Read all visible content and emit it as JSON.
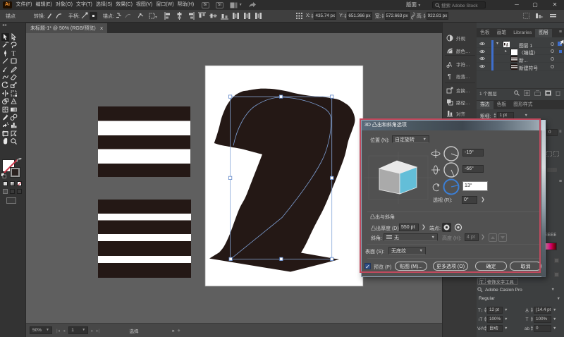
{
  "window": {
    "logo": "Ai",
    "workspace": "版面",
    "search_placeholder": "搜索 Adobe Stock",
    "minimize": "─",
    "maximize": "▢",
    "close": "✕"
  },
  "menu": {
    "items": [
      "文件(F)",
      "编辑(E)",
      "对象(O)",
      "文字(T)",
      "选择(S)",
      "效果(C)",
      "视图(V)",
      "窗口(W)",
      "帮助(H)"
    ],
    "bridge_icon": "Br",
    "stock_icon": "St"
  },
  "control_bar": {
    "mode_label": "锚点",
    "convert_label": "转换:",
    "handles_label": "手柄:",
    "anchors_label": "锚点:",
    "x_label": "X:",
    "x_value": "435.74 px",
    "y_label": "Y:",
    "y_value": "651.366 px",
    "w_label": "宽:",
    "w_value": "572.663 px",
    "h_label": "高:",
    "h_value": "922.81 px"
  },
  "document_tab": {
    "title": "未标题-1* @ 50% (RGB/预览)",
    "close": "×"
  },
  "tools": [
    "selection",
    "direct-selection",
    "magic-wand",
    "lasso",
    "pen",
    "type",
    "line-segment",
    "rectangle",
    "paintbrush",
    "pencil",
    "shaper",
    "eraser",
    "rotate",
    "scale",
    "width",
    "free-transform",
    "shape-builder",
    "perspective-grid",
    "mesh",
    "gradient",
    "eyedropper",
    "blend",
    "symbol-sprayer",
    "column-graph",
    "artboard",
    "slice",
    "hand",
    "zoom"
  ],
  "dock_strip": [
    {
      "icon": "appearance-icon",
      "label": "外观"
    },
    {
      "icon": "color-icon",
      "label": "颜色…"
    },
    {
      "icon": "character-icon",
      "label": "字符…"
    },
    {
      "icon": "paragraph-icon",
      "label": "段落…"
    },
    {
      "icon": "transform-icon",
      "label": "变换…"
    },
    {
      "icon": "pathfinder-icon",
      "label": "路径…"
    },
    {
      "icon": "align-icon",
      "label": "对齐"
    }
  ],
  "layers_panel": {
    "tabs": [
      "色板",
      "画笔",
      "Libraries",
      "图层"
    ],
    "active_tab": "图层",
    "rows": [
      {
        "name": "图层 1",
        "thumb": "artwork",
        "expander": "v",
        "indent": 0
      },
      {
        "name": "〈编组〉",
        "thumb": "group",
        "expander": ">",
        "indent": 1
      },
      {
        "name": "新...",
        "thumb": "stripes",
        "expander": "",
        "indent": 1
      },
      {
        "name": "新建符号",
        "thumb": "stripes",
        "expander": "",
        "indent": 1
      }
    ],
    "status": "1 个图层"
  },
  "stroke_panel": {
    "tabs": [
      "描边",
      "色板",
      "图形样式"
    ],
    "active_tab": "描边",
    "weight_label": "粗细:",
    "weight_value": "1 pt"
  },
  "side_sliver": {
    "value": "0",
    "hex_text": "EEEE"
  },
  "character_panel": {
    "touch_tool": "修饰文字工具",
    "font_name": "Adobe Caslon Pro",
    "font_style": "Regular",
    "size_value": "12 pt",
    "leading_value": "(14.4 pt)",
    "vscale_value": "100%",
    "hscale_value": "100%",
    "kerning_value": "自动",
    "tracking_value": "0"
  },
  "dialog": {
    "title": "3D 凸出和斜角选项",
    "position_label": "位置 (N):",
    "position_value": "自定旋转",
    "rotate_x": "-19°",
    "rotate_y": "-66°",
    "rotate_z": "13°",
    "perspective_label": "透视 (R):",
    "perspective_value": "0°",
    "section_label": "凸出与斜角",
    "depth_label": "凸出厚度 (D):",
    "depth_value": "550 pt",
    "cap_label": "端点:",
    "bevel_label": "斜角:",
    "bevel_value": "无",
    "height_label": "高度 (H):",
    "height_value": "4 pt",
    "surface_label": "表面 (S):",
    "surface_value": "无底纹",
    "preview_label": "预览 (P)",
    "map_button": "贴图 (M)...",
    "more_button": "更多选项 (O)",
    "ok_button": "确定",
    "cancel_button": "取消"
  },
  "status_bar": {
    "zoom": "50%",
    "artboard": "1",
    "tool_status": "选择"
  },
  "colors": {
    "chrome": "#2d2d2d",
    "panel": "#3f3f3f",
    "pasteboard": "#5f5f5f",
    "artboard": "#ffffff",
    "ink": "#241815",
    "selection_blue": "#87a7d8",
    "accent_blue": "#3b7fd6",
    "annotation_red": "#c04a5e",
    "cube_cyan": "#63bed8",
    "logo_orange": "#ff9a33",
    "gradient_swatch": [
      "#ffffff",
      "#f650a4",
      "#e4007f",
      "#a50029",
      "#4d000c"
    ]
  }
}
